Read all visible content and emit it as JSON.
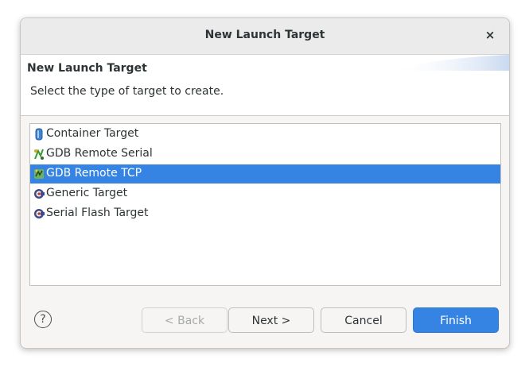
{
  "window": {
    "title": "New Launch Target",
    "close_glyph": "×"
  },
  "header": {
    "title": "New Launch Target",
    "description": "Select the type of target to create."
  },
  "list": {
    "items": [
      {
        "label": "Container Target",
        "icon": "container-icon",
        "selected": false
      },
      {
        "label": "GDB Remote Serial",
        "icon": "gdb-serial-icon",
        "selected": false
      },
      {
        "label": "GDB Remote TCP",
        "icon": "gdb-tcp-icon",
        "selected": true
      },
      {
        "label": "Generic Target",
        "icon": "generic-target-icon",
        "selected": false
      },
      {
        "label": "Serial Flash Target",
        "icon": "serial-flash-icon",
        "selected": false
      }
    ]
  },
  "buttons": {
    "help": "?",
    "back": "< Back",
    "next": "Next >",
    "cancel": "Cancel",
    "finish": "Finish"
  },
  "colors": {
    "accent": "#3584e4",
    "selection_text": "#ffffff"
  }
}
